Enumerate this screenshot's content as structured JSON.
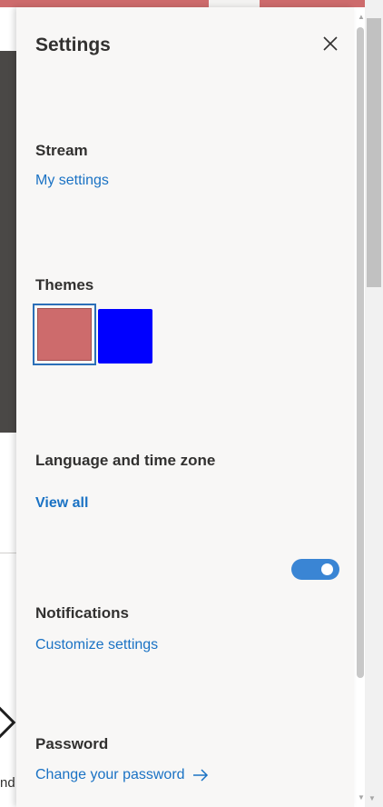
{
  "panel": {
    "title": "Settings",
    "close_icon": "close-icon"
  },
  "stream": {
    "title": "Stream",
    "link": "My settings"
  },
  "themes": {
    "title": "Themes",
    "swatches": [
      {
        "color": "#cd6b6c",
        "selected": true
      },
      {
        "color": "#0000ff",
        "selected": false
      }
    ]
  },
  "language": {
    "title": "Language and time zone",
    "link": "View all"
  },
  "notifications": {
    "title": "Notifications",
    "link": "Customize settings",
    "toggle_on": true
  },
  "password": {
    "title": "Password",
    "link": "Change your password",
    "link_icon": "arrow-right-icon"
  },
  "background": {
    "partial_text": "nd"
  },
  "colors": {
    "accent": "#cd6b6c",
    "link": "#1a72c4",
    "toggle": "#3a85d4"
  }
}
